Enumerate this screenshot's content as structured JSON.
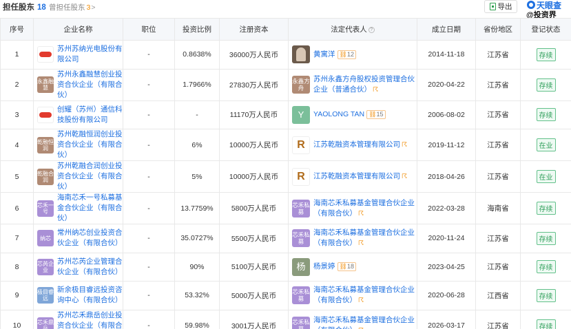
{
  "header": {
    "title": "担任股东",
    "count": "18",
    "former_label": "曾担任股东",
    "former_count": "3",
    "former_arrow": ">",
    "export_label": "导出",
    "brand": "天眼查",
    "watermark": "@投资界"
  },
  "columns": [
    "序号",
    "企业名称",
    "职位",
    "投资比例",
    "注册资本",
    "法定代表人",
    "成立日期",
    "省份地区",
    "登记状态"
  ],
  "rows": [
    {
      "no": "1",
      "name": "苏州苏纳光电股份有限公司",
      "logo": "",
      "logo_style": "img",
      "position": "-",
      "ratio": "0.8638%",
      "capital": "36000万人民币",
      "rep": "黄寓洋",
      "rep_logo": "",
      "rep_style": "photo",
      "rep_badge": "12",
      "date": "2014-11-18",
      "region": "江苏省",
      "status": "存续"
    },
    {
      "no": "2",
      "name": "苏州永鑫融慧创业投资合伙企业（有限合伙）",
      "logo": "永鑫融慧",
      "logo_style": "brown",
      "position": "-",
      "ratio": "1.7966%",
      "capital": "27830万人民币",
      "rep": "苏州永鑫方舟股权投资管理合伙企业（普通合伙）",
      "rep_logo": "永鑫方舟",
      "rep_style": "brown",
      "rep_badge": "",
      "rep_ctrl": "☈",
      "date": "2020-04-22",
      "region": "江苏省",
      "status": "存续"
    },
    {
      "no": "3",
      "name": "创耀（苏州）通信科技股份有限公司",
      "logo": "",
      "logo_style": "img",
      "position": "-",
      "ratio": "-",
      "capital": "11170万人民币",
      "rep": "YAOLONG TAN",
      "rep_logo": "Y",
      "rep_style": "teal",
      "rep_badge": "15",
      "date": "2006-08-02",
      "region": "江苏省",
      "status": "存续"
    },
    {
      "no": "4",
      "name": "苏州乾融恒润创业投资合伙企业（有限合伙）",
      "logo": "乾融恒润",
      "logo_style": "brown",
      "position": "-",
      "ratio": "6%",
      "capital": "10000万人民币",
      "rep": "江苏乾融资本管理有限公司",
      "rep_logo": "R",
      "rep_style": "r",
      "rep_badge": "",
      "rep_ctrl": "☈",
      "date": "2019-11-12",
      "region": "江苏省",
      "status": "在业"
    },
    {
      "no": "5",
      "name": "苏州乾融合润创业投资合伙企业（有限合伙）",
      "logo": "乾融合润",
      "logo_style": "brown",
      "position": "-",
      "ratio": "5%",
      "capital": "10000万人民币",
      "rep": "江苏乾融资本管理有限公司",
      "rep_logo": "R",
      "rep_style": "r",
      "rep_badge": "",
      "rep_ctrl": "☈",
      "date": "2018-04-26",
      "region": "江苏省",
      "status": "在业"
    },
    {
      "no": "6",
      "name": "海南芯禾一号私募基金合伙企业（有限合伙）",
      "logo": "芯禾一号",
      "logo_style": "purple",
      "position": "-",
      "ratio": "13.7759%",
      "capital": "5800万人民币",
      "rep": "海南芯禾私募基金管理合伙企业（有限合伙）",
      "rep_logo": "芯禾私募",
      "rep_style": "purple",
      "rep_badge": "",
      "rep_ctrl": "☈",
      "date": "2022-03-28",
      "region": "海南省",
      "status": "存续"
    },
    {
      "no": "7",
      "name": "常州纳芯创业投资合伙企业（有限合伙）",
      "logo": "纳芯",
      "logo_style": "purple",
      "position": "-",
      "ratio": "35.0727%",
      "capital": "5500万人民币",
      "rep": "海南芯禾私募基金管理合伙企业（有限合伙）",
      "rep_logo": "芯禾私募",
      "rep_style": "purple",
      "rep_badge": "",
      "rep_ctrl": "☈",
      "date": "2020-11-24",
      "region": "江苏省",
      "status": "存续"
    },
    {
      "no": "8",
      "name": "苏州芯芮企业管理合伙企业（有限合伙）",
      "logo": "芯芮企业",
      "logo_style": "purple",
      "position": "-",
      "ratio": "90%",
      "capital": "5100万人民币",
      "rep": "杨景婷",
      "rep_logo": "杨",
      "rep_style": "olive",
      "rep_badge": "18",
      "date": "2023-04-25",
      "region": "江苏省",
      "status": "存续"
    },
    {
      "no": "9",
      "name": "新余极目睿远投资咨询中心（有限合伙）",
      "logo": "极目睿远",
      "logo_style": "blue",
      "position": "-",
      "ratio": "53.32%",
      "capital": "5000万人民币",
      "rep": "海南芯禾私募基金管理合伙企业（有限合伙）",
      "rep_logo": "芯禾私募",
      "rep_style": "purple",
      "rep_badge": "",
      "rep_ctrl": "☈",
      "date": "2020-06-28",
      "region": "江西省",
      "status": "存续"
    },
    {
      "no": "10",
      "name": "苏州芯禾鼎岳创业投资合伙企业（有限合伙）",
      "logo": "芯禾鼎岳",
      "logo_style": "purple",
      "position": "-",
      "ratio": "59.98%",
      "capital": "3001万人民币",
      "rep": "海南芯禾私募基金管理合伙企业（有限合伙）",
      "rep_logo": "芯禾私募",
      "rep_style": "purple",
      "rep_badge": "",
      "rep_ctrl": "☈",
      "date": "2026-03-17",
      "region": "江苏省",
      "status": "存续"
    }
  ]
}
